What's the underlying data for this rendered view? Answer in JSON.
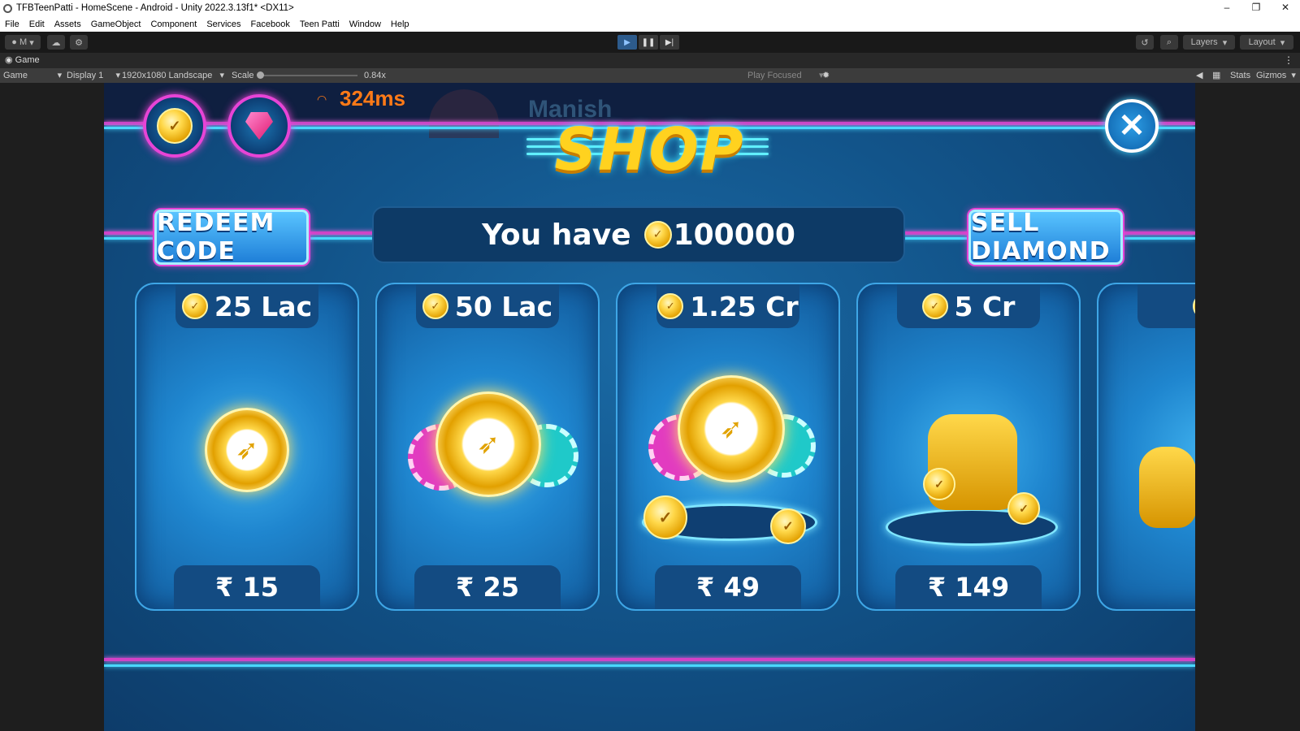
{
  "window": {
    "title": "TFBTeenPatti - HomeScene - Android - Unity 2022.3.13f1* <DX11>",
    "controls": [
      "–",
      "❐",
      "✕"
    ]
  },
  "menu": [
    "File",
    "Edit",
    "Assets",
    "GameObject",
    "Component",
    "Services",
    "Facebook",
    "Teen Patti",
    "Window",
    "Help"
  ],
  "toolbar": {
    "account": "M",
    "layers": "Layers",
    "layout": "Layout"
  },
  "game_tab": {
    "label": "Game"
  },
  "game_bar": {
    "view": "Game",
    "display": "Display 1",
    "resolution": "1920x1080 Landscape",
    "scale_label": "Scale",
    "scale_value": "0.84x",
    "play_mode": "Play Focused",
    "stats": "Stats",
    "gizmos": "Gizmos"
  },
  "hud": {
    "ping": "324ms",
    "player_name": "Manish"
  },
  "shop": {
    "title": "SHOP",
    "redeem_label": "REDEEM CODE",
    "sell_label": "SELL DIAMOND",
    "balance_prefix": "You have",
    "balance_value": "100000",
    "packs": [
      {
        "amount": "25 Lac",
        "price": "₹ 15"
      },
      {
        "amount": "50 Lac",
        "price": "₹ 25"
      },
      {
        "amount": "1.25 Cr",
        "price": "₹ 49"
      },
      {
        "amount": "5 Cr",
        "price": "₹ 149"
      }
    ]
  },
  "colors": {
    "accent_pink": "#d340c6",
    "accent_cyan": "#49d8ff",
    "gold": "#ffd21f"
  }
}
